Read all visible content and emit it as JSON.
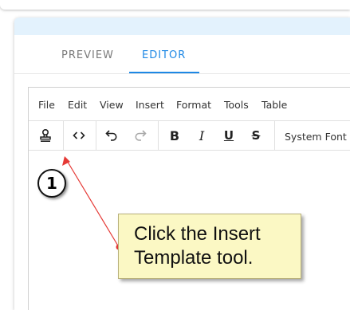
{
  "tabs": [
    {
      "label": "PREVIEW",
      "active": false
    },
    {
      "label": "EDITOR",
      "active": true
    }
  ],
  "menu": [
    "File",
    "Edit",
    "View",
    "Insert",
    "Format",
    "Tools",
    "Table"
  ],
  "toolbar": {
    "buttons": [
      {
        "icon": "insert-template-icon"
      },
      {
        "icon": "source-code-icon"
      },
      {
        "icon": "undo-icon"
      },
      {
        "icon": "redo-icon",
        "disabled": true
      },
      {
        "icon": "bold-icon",
        "glyph": "B"
      },
      {
        "icon": "italic-icon",
        "glyph": "I"
      },
      {
        "icon": "underline-icon",
        "glyph": "U"
      },
      {
        "icon": "strikethrough-icon",
        "glyph": "S"
      }
    ],
    "font": "System Font"
  },
  "annotation": {
    "step": "1",
    "callout_line1": "Click the Insert",
    "callout_line2": "Template tool."
  },
  "colors": {
    "accent": "#1e88e5",
    "panel_header": "#e3f2fd",
    "callout_bg": "#fbf8c4",
    "arrow": "#e53935"
  }
}
